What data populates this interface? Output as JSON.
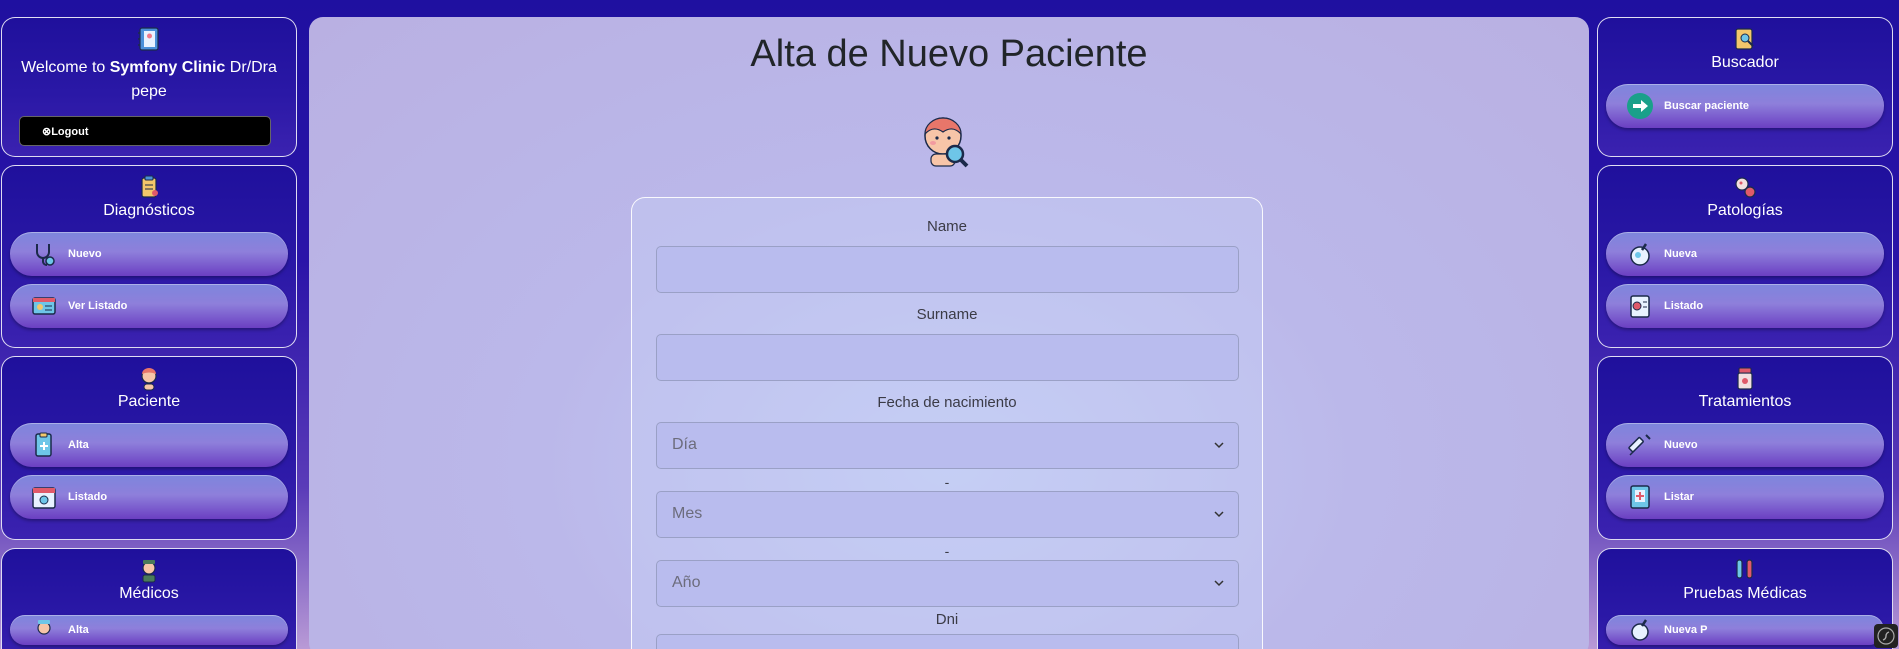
{
  "left_sidebar": {
    "welcome": {
      "prefix": "Welcome to ",
      "brand": "Symfony Clinic",
      "suffix": " Dr/Dra",
      "user": "pepe"
    },
    "logout_label": "⊗Logout",
    "diagnosticos": {
      "title": "Diagnósticos",
      "items": [
        "Nuevo",
        "Ver Listado"
      ]
    },
    "paciente": {
      "title": "Paciente",
      "items": [
        "Alta",
        "Listado"
      ]
    },
    "medicos": {
      "title": "Médicos",
      "items": [
        "Alta"
      ]
    }
  },
  "right_sidebar": {
    "buscador": {
      "title": "Buscador",
      "items": [
        "Buscar paciente"
      ]
    },
    "patologias": {
      "title": "Patologías",
      "items": [
        "Nueva",
        "Listado"
      ]
    },
    "tratamientos": {
      "title": "Tratamientos",
      "items": [
        "Nuevo",
        "Listar"
      ]
    },
    "pruebas": {
      "title": "Pruebas Médicas",
      "items": [
        "Nueva P"
      ]
    }
  },
  "main": {
    "title": "Alta de Nuevo Paciente",
    "form": {
      "name_label": "Name",
      "surname_label": "Surname",
      "birth_label": "Fecha de nacimiento",
      "day_placeholder": "Día",
      "month_placeholder": "Mes",
      "year_placeholder": "Año",
      "separator": "-",
      "dni_label": "Dni"
    }
  },
  "icons": {
    "header": "notebook-icon",
    "diagnosticos": "clipboard-icon",
    "paciente": "patient-icon",
    "medicos": "doctor-icon",
    "buscador": "search-book-icon",
    "patologias": "virus-icon",
    "tratamientos": "medicine-jar-icon",
    "pruebas": "test-tubes-icon"
  },
  "colors": {
    "accent_teal": "#1aa08a",
    "panel_bg": "#22129f",
    "pill_top": "#7d86dc",
    "pill_bottom": "#6b3fc2"
  }
}
